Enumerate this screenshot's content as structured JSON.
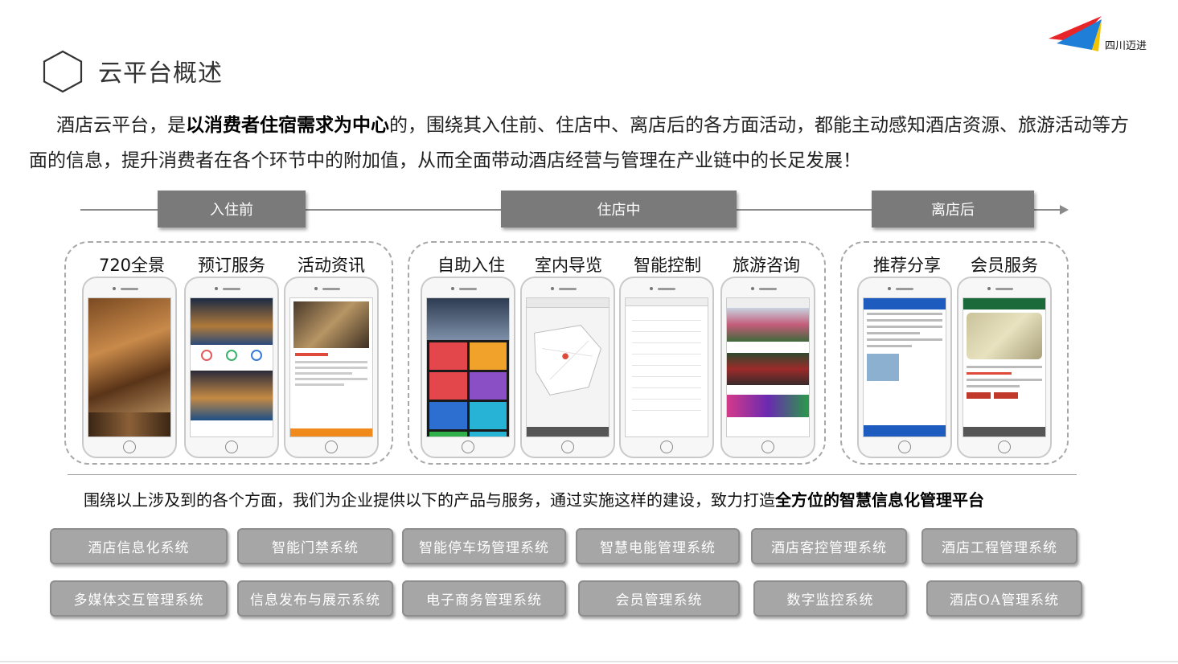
{
  "header": {
    "title": "云平台概述",
    "brand_name": "四川迈进"
  },
  "intro": {
    "prefix": "酒店云平台，是",
    "emphasis": "以消费者住宿需求为中心",
    "suffix": "的，围绕其入住前、住店中、离店后的各方面活动，都能主动感知酒店资源、旅游活动等方面的信息，提升消费者在各个环节中的附加值，从而全面带动酒店经营与管理在产业链中的长足发展！"
  },
  "phases": [
    {
      "label": "入住前"
    },
    {
      "label": "住店中"
    },
    {
      "label": "离店后"
    }
  ],
  "features": [
    {
      "label": "720全景"
    },
    {
      "label": "预订服务"
    },
    {
      "label": "活动资讯"
    },
    {
      "label": "自助入住"
    },
    {
      "label": "室内导览"
    },
    {
      "label": "智能控制"
    },
    {
      "label": "旅游咨询"
    },
    {
      "label": "推荐分享"
    },
    {
      "label": "会员服务"
    }
  ],
  "summary": {
    "prefix": "围绕以上涉及到的各个方面，我们为企业提供以下的产品与服务，通过实施这样的建设，致力打造",
    "emphasis": "全方位的智慧信息化管理平台"
  },
  "systems": [
    "酒店信息化系统",
    "智能门禁系统",
    "智能停车场管理系统",
    "智慧电能管理系统",
    "酒店客控管理系统",
    "酒店工程管理系统",
    "多媒体交互管理系统",
    "信息发布与展示系统",
    "电子商务管理系统",
    "会员管理系统",
    "数字监控系统",
    "酒店OA管理系统"
  ],
  "colors": {
    "phase_bg": "#7a7a7a",
    "system_bg": "#a6a6a6",
    "logo_red": "#e8262a",
    "logo_blue": "#1f7fd8",
    "logo_yellow": "#f5c400"
  },
  "icons": [
    "hexagon-icon",
    "brand-logo",
    "timeline-arrow-icon",
    "phone-mockup"
  ]
}
